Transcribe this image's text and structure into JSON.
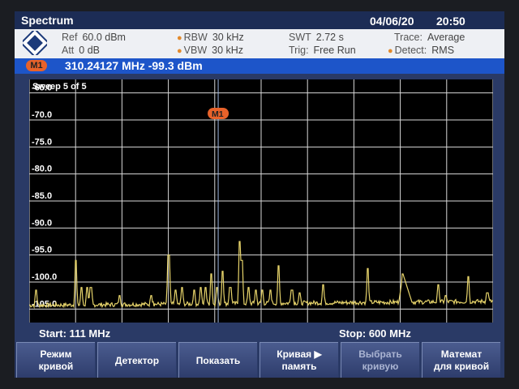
{
  "titlebar": {
    "app": "Spectrum",
    "date": "04/06/20",
    "time": "20:50"
  },
  "settings": {
    "ref_label": "Ref",
    "ref_value": "60.0 dBm",
    "att_label": "Att",
    "att_value": "0 dB",
    "rbw_label": "RBW",
    "rbw_value": "30 kHz",
    "vbw_label": "VBW",
    "vbw_value": "30 kHz",
    "swt_label": "SWT",
    "swt_value": "2.72 s",
    "trig_label": "Trig:",
    "trig_value": "Free Run",
    "trace_label": "Trace:",
    "trace_value": "Average",
    "detect_label": "Detect:",
    "detect_value": "RMS"
  },
  "marker": {
    "badge": "M1",
    "readout": "310.24127 MHz -99.3  dBm"
  },
  "plot": {
    "sweep": "Sweep 5 of 5",
    "marker_label": "M1"
  },
  "freq": {
    "start": "Start:  111 MHz",
    "stop": "Stop: 600 MHz"
  },
  "softkeys": [
    {
      "line1": "Режим",
      "line2": "кривой"
    },
    {
      "line1": "Детектор",
      "line2": ""
    },
    {
      "line1": "Показать",
      "line2": ""
    },
    {
      "line1": "Кривая ▶",
      "line2": "память"
    },
    {
      "line1": "Выбрать",
      "line2": "кривую"
    },
    {
      "line1": "Математ",
      "line2": "для кривой"
    }
  ],
  "chart_data": {
    "type": "line",
    "xlabel": "",
    "ylabel": "",
    "xlim": [
      111,
      600
    ],
    "ylim": [
      -107.5,
      -62.5
    ],
    "y_ticks": [
      "-65.0",
      "-70.0",
      "-75.0",
      "-80.0",
      "-85.0",
      "-90.0",
      "-95.0",
      "-100.0",
      "-105.0"
    ],
    "y_tick_values": [
      -65,
      -70,
      -75,
      -80,
      -85,
      -90,
      -95,
      -100,
      -105
    ],
    "grid": true,
    "trace_color": "#e6d36a",
    "marker": {
      "name": "M1",
      "x": 310.24,
      "y": -99.3
    },
    "series": [
      {
        "peaks": [
          [
            118,
            -101.5
          ],
          [
            160,
            -96
          ],
          [
            166,
            -101
          ],
          [
            172,
            -101
          ],
          [
            176,
            -101
          ],
          [
            206,
            -102.5
          ],
          [
            240,
            -102.5
          ],
          [
            258,
            -95
          ],
          [
            265,
            -101.5
          ],
          [
            272,
            -101
          ],
          [
            285,
            -101.5
          ],
          [
            292,
            -101
          ],
          [
            297,
            -101
          ],
          [
            303,
            -98.5
          ],
          [
            309,
            -101
          ],
          [
            315,
            -98
          ],
          [
            323,
            -101
          ],
          [
            333,
            -92.5
          ],
          [
            335,
            -96
          ],
          [
            342,
            -101
          ],
          [
            350,
            -101.5
          ],
          [
            357,
            -101.5
          ],
          [
            365,
            -101.5
          ],
          [
            374,
            -97
          ],
          [
            388,
            -101.5
          ],
          [
            396,
            -102
          ],
          [
            421,
            -100.5
          ],
          [
            468,
            -97.5
          ],
          [
            505,
            -98.5
          ],
          [
            542,
            -100.5
          ],
          [
            550,
            -102.5
          ],
          [
            574,
            -99
          ],
          [
            594,
            -102
          ]
        ]
      }
    ]
  }
}
